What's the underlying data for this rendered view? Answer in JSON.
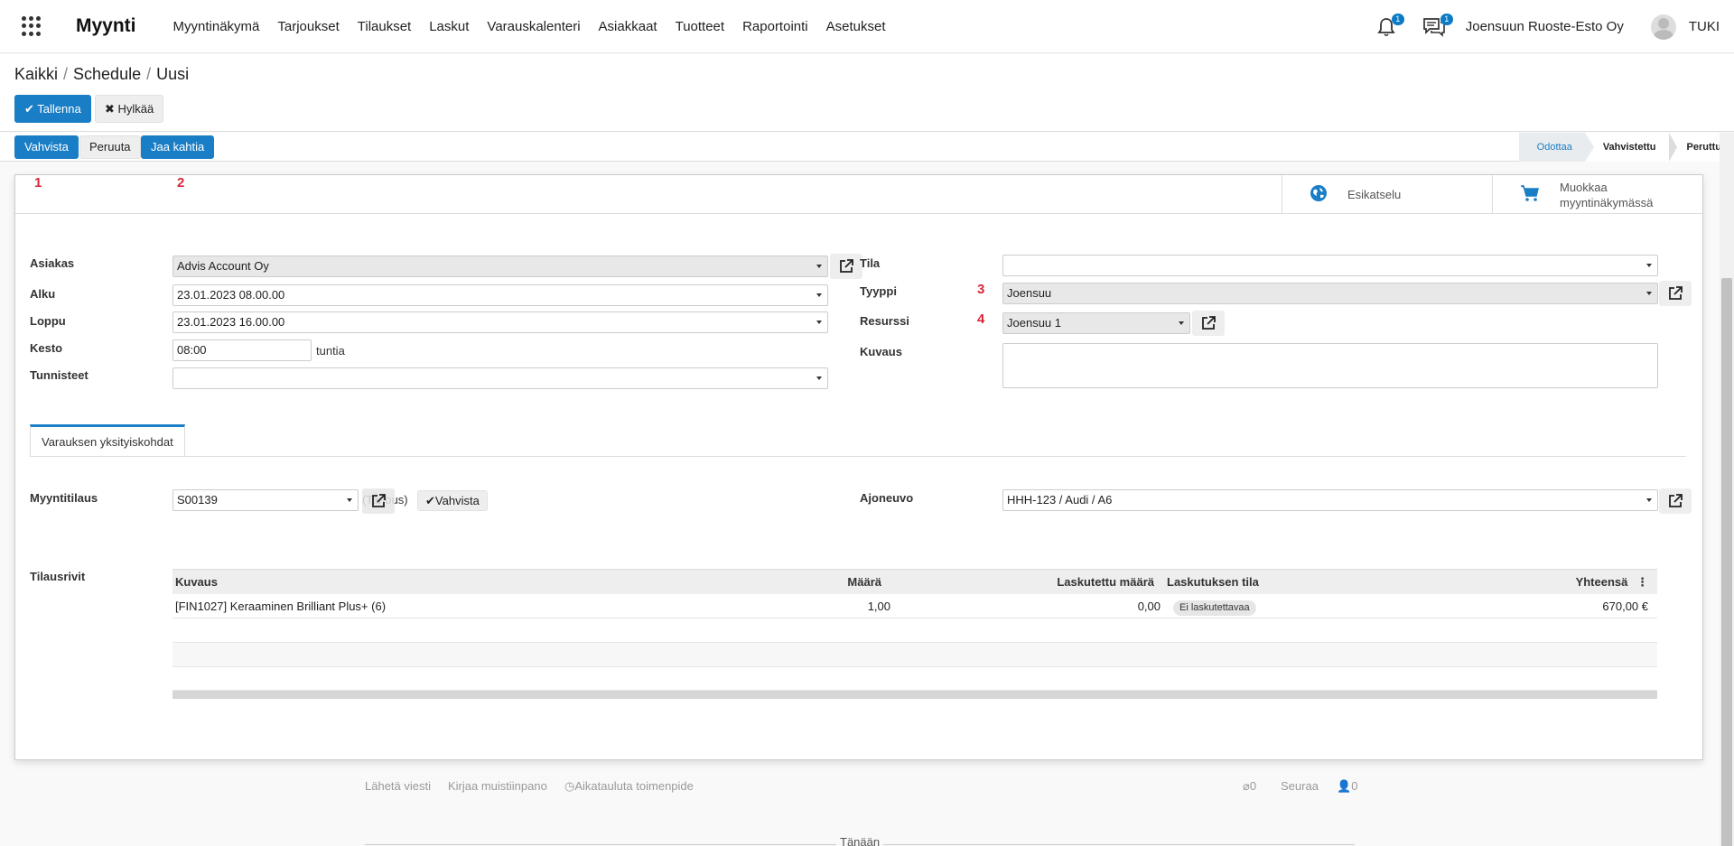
{
  "nav": {
    "brand": "Myynti",
    "menu": [
      "Myyntinäkymä",
      "Tarjoukset",
      "Tilaukset",
      "Laskut",
      "Varauskalenteri",
      "Asiakkaat",
      "Tuotteet",
      "Raportointi",
      "Asetukset"
    ],
    "notifications_count": "1",
    "messages_count": "1",
    "company": "Joensuun Ruoste-Esto Oy",
    "user": "TUKI"
  },
  "breadcrumb": [
    "Kaikki",
    "Schedule",
    "Uusi"
  ],
  "actions": {
    "save": "Tallenna",
    "discard": "Hylkää"
  },
  "statusbar": {
    "buttons": [
      "Vahvista",
      "Peruuta",
      "Jaa kahtia"
    ],
    "stages": [
      "Odottaa",
      "Vahvistettu",
      "Peruttu"
    ],
    "active_stage": "Odottaa"
  },
  "markers": [
    "1",
    "2",
    "3",
    "4"
  ],
  "smart_buttons": {
    "preview": "Esikatselu",
    "edit_line1": "Muokkaa",
    "edit_line2": "myyntinäkymässä"
  },
  "form": {
    "customer": {
      "label": "Asiakas",
      "value": "Advis Account Oy"
    },
    "start": {
      "label": "Alku",
      "value": "23.01.2023 08.00.00"
    },
    "end": {
      "label": "Loppu",
      "value": "23.01.2023 16.00.00"
    },
    "duration": {
      "label": "Kesto",
      "value": "08:00",
      "unit": "tuntia"
    },
    "tags": {
      "label": "Tunnisteet",
      "value": ""
    },
    "state": {
      "label": "Tila",
      "value": ""
    },
    "type": {
      "label": "Tyyppi",
      "value": "Joensuu"
    },
    "resource": {
      "label": "Resurssi",
      "value": "Joensuu 1"
    },
    "description": {
      "label": "Kuvaus",
      "value": ""
    }
  },
  "tab": {
    "label": "Varauksen yksityiskohdat"
  },
  "details": {
    "sales_order": {
      "label": "Myyntitilaus",
      "value": "S00139",
      "state": "(Tarjous)",
      "confirm": "Vahvista"
    },
    "vehicle": {
      "label": "Ajoneuvo",
      "value": "HHH-123 / Audi / A6"
    },
    "order_lines_label": "Tilausrivit"
  },
  "order_lines": {
    "columns": [
      "Kuvaus",
      "Määrä",
      "Laskutettu määrä",
      "Laskutuksen tila",
      "Yhteensä"
    ],
    "rows": [
      {
        "description": "[FIN1027] Keraaminen Brilliant Plus+ (6)",
        "qty": "1,00",
        "invoiced_qty": "0,00",
        "invoice_status": "Ei laskutettavaa",
        "total": "670,00 €"
      }
    ]
  },
  "chatter": {
    "send_message": "Lähetä viesti",
    "log_note": "Kirjaa muistiinpano",
    "schedule_activity": "Aikatauluta toimenpide",
    "attachments": "0",
    "follow": "Seuraa",
    "followers": "0",
    "today": "Tänään"
  }
}
